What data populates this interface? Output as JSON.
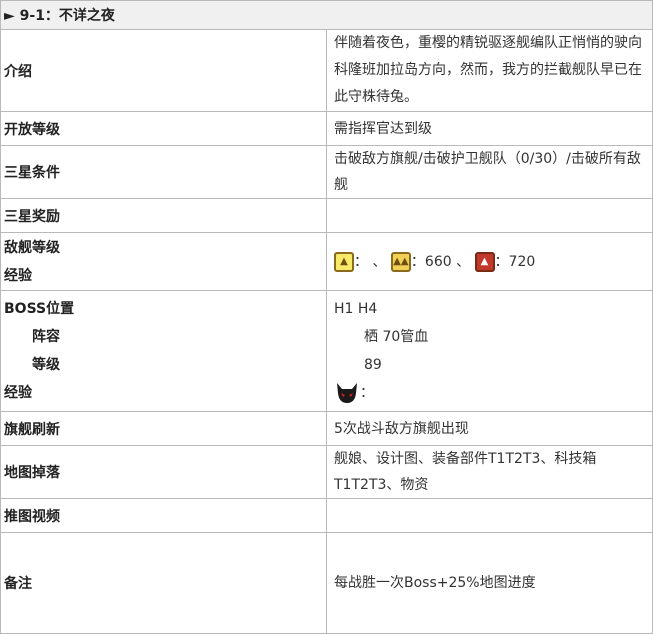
{
  "title": "► 9-1：不详之夜",
  "rows": {
    "intro": {
      "label": "介绍",
      "value": "伴随着夜色，重樱的精锐驱逐舰编队正悄悄的驶向科隆班加拉岛方向，然而，我方的拦截舰队早已在此守株待兔。"
    },
    "unlock": {
      "label": "开放等级",
      "value": "需指挥官达到级"
    },
    "three_star_cond": {
      "label": "三星条件",
      "value": "击破敌方旗舰/击破护卫舰队（0/30）/击破所有敌舰"
    },
    "three_star_reward": {
      "label": "三星奖励",
      "value": ""
    },
    "enemy_level": {
      "label_1": "敌舰等级",
      "label_2": "经验",
      "sep_1": "： 、",
      "sep_2": "：660 、",
      "sep_3": "：720",
      "icons": [
        "rank-1-triangle-icon",
        "rank-2-triangle-icon",
        "rank-3-triangle-icon"
      ]
    },
    "boss": {
      "label_pos": "BOSS位置",
      "label_formation": "阵容",
      "label_level": "等级",
      "label_exp": "经验",
      "pos": "H1 H4",
      "formation": "栖 70管血",
      "level": "89",
      "exp": "：",
      "icon": "boss-devil-icon"
    },
    "flagship_refresh": {
      "label": "旗舰刷新",
      "value": "5次战斗敌方旗舰出现"
    },
    "map_drops": {
      "label": "地图掉落",
      "value": "舰娘、设计图、装备部件T1T2T3、科技箱T1T2T3、物资"
    },
    "video": {
      "label": "推图视频",
      "value": ""
    },
    "notes": {
      "label": "备注",
      "value": "每战胜一次Boss+25%地图进度"
    }
  },
  "colors": {
    "border": "#b9b9b9",
    "title_bg": "#f0f0f0",
    "text": "#333333"
  }
}
